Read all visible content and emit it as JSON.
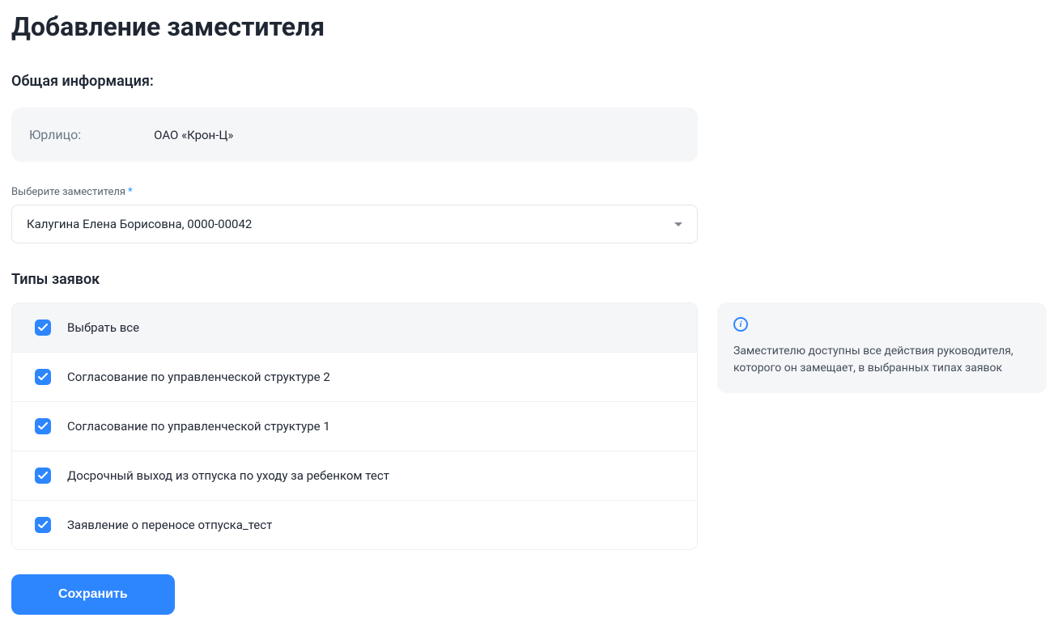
{
  "title": "Добавление заместителя",
  "general": {
    "heading": "Общая информация:",
    "entity_label": "Юрлицо:",
    "entity_value": "ОАО «Крон-Ц»"
  },
  "deputy": {
    "label": "Выберите заместителя",
    "required_mark": "*",
    "selected": "Калугина Елена Борисовна, 0000-00042"
  },
  "types": {
    "heading": "Типы заявок",
    "select_all": "Выбрать все",
    "items": [
      "Согласование по управленческой структуре 2",
      "Согласование по управленческой структуре 1",
      "Досрочный выход из отпуска по уходу за ребенком тест",
      "Заявление о переносе отпуска_тест"
    ]
  },
  "note": {
    "icon_text": "i",
    "text": "Заместителю доступны все действия руководителя, которого он замещает, в выбранных типах заявок"
  },
  "actions": {
    "save": "Сохранить"
  }
}
